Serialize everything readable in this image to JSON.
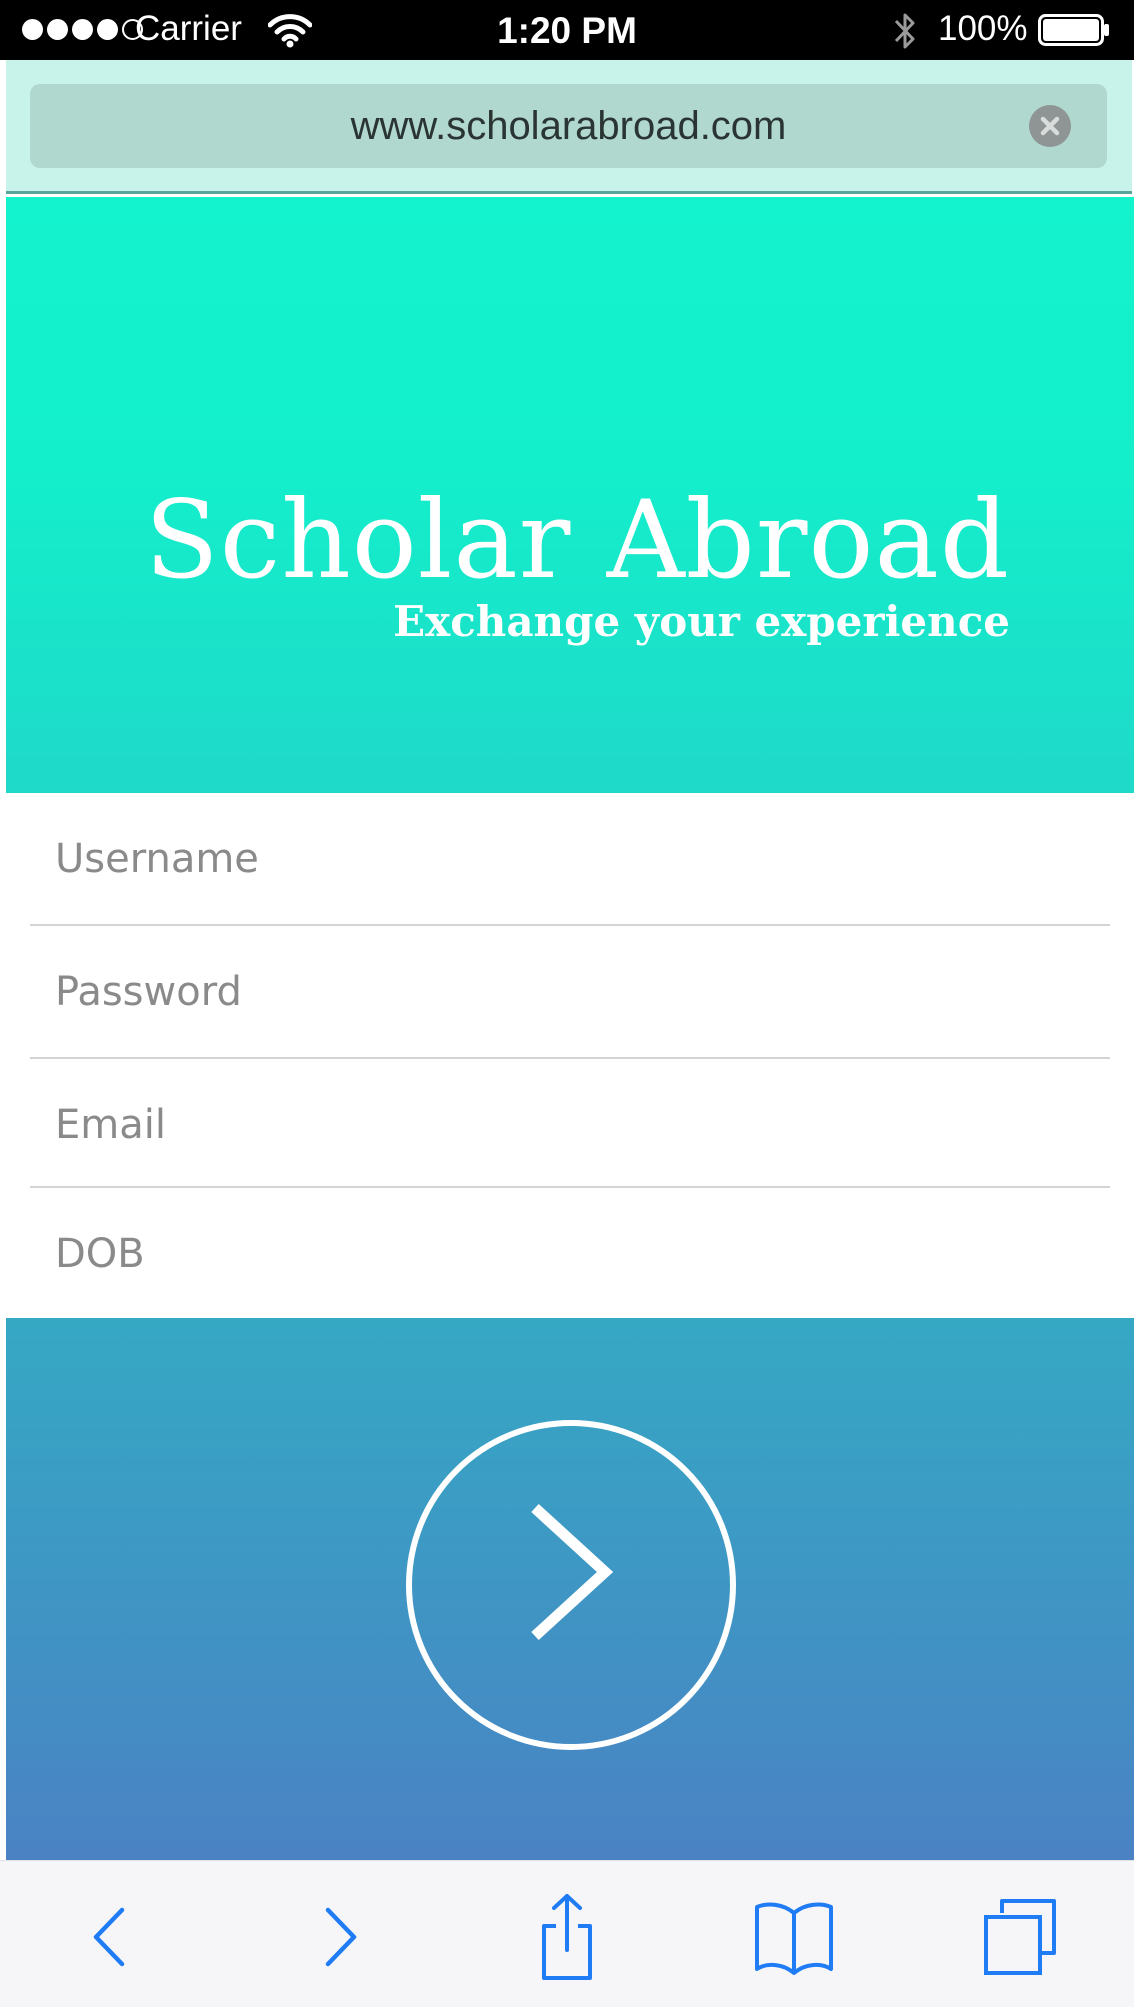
{
  "status_bar": {
    "carrier": "Carrier",
    "time": "1:20 PM",
    "battery_percent": "100%",
    "signal_bars_filled": 4,
    "signal_bars_total": 5,
    "icons": [
      "wifi-icon",
      "bluetooth-icon",
      "battery-icon"
    ]
  },
  "browser": {
    "url": "www.scholarabroad.com",
    "clear_icon": "clear-icon"
  },
  "hero": {
    "title": "Scholar Abroad",
    "subtitle": "Exchange your experience"
  },
  "form": {
    "fields": [
      {
        "placeholder": "Username",
        "value": ""
      },
      {
        "placeholder": "Password",
        "value": ""
      },
      {
        "placeholder": "Email",
        "value": ""
      },
      {
        "placeholder": "DOB",
        "value": ""
      }
    ]
  },
  "submit": {
    "icon": "chevron-right-icon"
  },
  "toolbar": {
    "items": [
      "back-icon",
      "forward-icon",
      "share-icon",
      "bookmarks-icon",
      "tabs-icon"
    ]
  },
  "colors": {
    "hero_top": "#13f3cd",
    "hero_bottom": "#1fd9c9",
    "submit_top": "#35a8c4",
    "submit_bottom": "#4a82c4",
    "toolbar_icon": "#1f7cf5",
    "url_bar": "#c8f3ea"
  }
}
